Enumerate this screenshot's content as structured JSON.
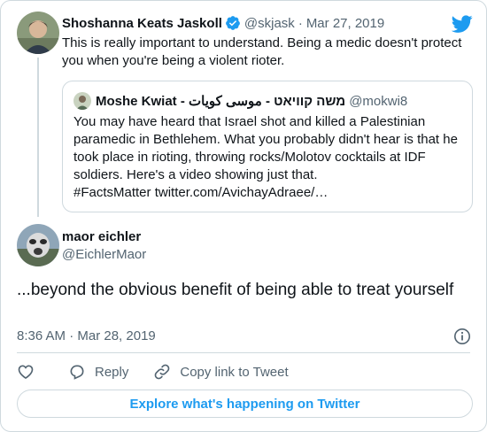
{
  "parent": {
    "name": "Shoshanna Keats Jaskoll",
    "handle": "@skjask",
    "separator": "·",
    "date": "Mar 27, 2019",
    "text": "This is really important to understand. Being a medic doesn't protect you when you're being a violent rioter.",
    "icons": {
      "verified": "verified-badge-icon",
      "brand": "twitter-bird-icon"
    }
  },
  "quote": {
    "name": "Moshe Kwiat - משה קוויאט - موسى كويات",
    "handle": "@mokwi8",
    "text": "You may have heard that Israel shot and killed a Palestinian paramedic in Bethlehem. What you probably didn't hear is that he took place in rioting, throwing rocks/Molotov cocktails at IDF soldiers. Here's a video showing just that.",
    "text_line2": "#FactsMatter twitter.com/AvichayAdraee/…"
  },
  "reply": {
    "name": "maor eichler",
    "handle": "@EichlerMaor",
    "text": "...beyond the obvious benefit of being able to treat yourself",
    "time": "8:36 AM · Mar 28, 2019"
  },
  "actions": {
    "like_icon": "heart-icon",
    "reply_label": "Reply",
    "copy_label": "Copy link to Tweet"
  },
  "explore_label": "Explore what's happening on Twitter",
  "colors": {
    "accent": "#1d9bf0",
    "muted": "#536471",
    "border": "#cfd9de",
    "text": "#0f1419"
  }
}
